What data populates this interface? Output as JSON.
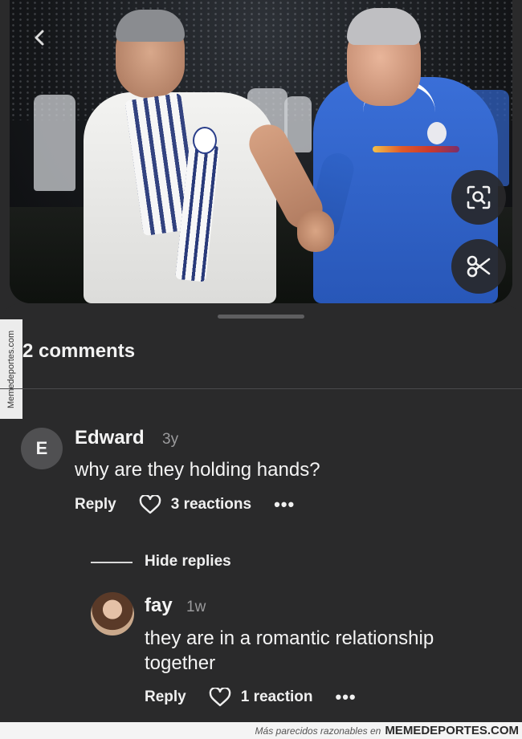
{
  "side_watermark": "Memedeportes.com",
  "photo": {
    "back_icon": "chevron-left-icon",
    "lens_icon": "visual-search-icon",
    "cut_icon": "scissors-icon"
  },
  "sheet": {
    "title": "2 comments"
  },
  "comments": [
    {
      "avatar_letter": "E",
      "author": "Edward",
      "age": "3y",
      "text": "why are they holding hands?",
      "reply_label": "Reply",
      "reactions": "3 reactions",
      "more_label": "•••"
    }
  ],
  "hide_replies_label": "Hide replies",
  "replies": [
    {
      "author": "fay",
      "age": "1w",
      "text": "they are in a romantic relationship together",
      "reply_label": "Reply",
      "reactions": "1 reaction",
      "more_label": "•••"
    }
  ],
  "footer": {
    "prefix": "Más parecidos razonables en",
    "brand": "MEMEDEPORTES.COM"
  },
  "colors": {
    "sheet_bg": "#2a2a2b",
    "text_primary": "#f4f4f4",
    "text_secondary": "#9b9b9d"
  }
}
